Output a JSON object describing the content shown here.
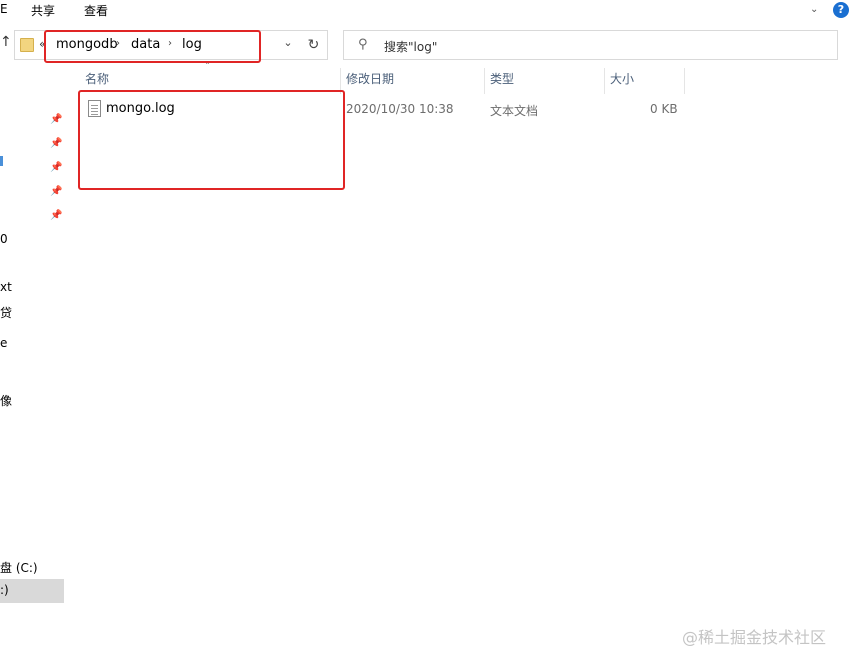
{
  "ribbon": {
    "edge_fragment": "E",
    "tabs": [
      "共享",
      "查看"
    ]
  },
  "address": {
    "overflow": "«",
    "breadcrumbs": [
      "mongodb",
      "data",
      "log"
    ]
  },
  "search": {
    "placeholder": "搜索\"log\""
  },
  "columns": {
    "name": "名称",
    "modified": "修改日期",
    "type": "类型",
    "size": "大小"
  },
  "files": [
    {
      "name": "mongo.log",
      "modified": "2020/10/30 10:38",
      "type": "文本文档",
      "size": "0 KB"
    }
  ],
  "nav_fragments": [
    "0",
    "xt",
    "贷",
    "e",
    "像",
    "盘 (C:)",
    ":)"
  ],
  "watermark": "@稀土掘金技术社区",
  "colors": {
    "annotation": "#e02525",
    "selection": "#d9d9d9",
    "header_text": "#4c607a"
  }
}
